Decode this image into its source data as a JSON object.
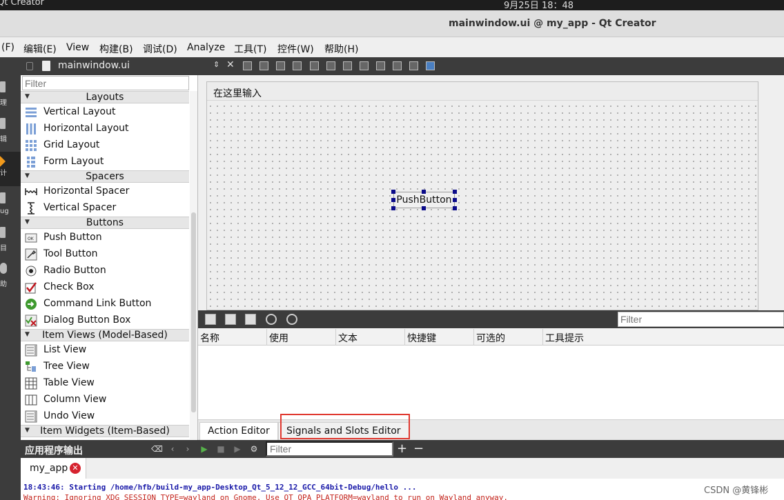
{
  "topbar": {
    "app_name": "Qt Creator",
    "clock": "9月25日  18：48"
  },
  "window": {
    "title": "mainwindow.ui @ my_app - Qt Creator"
  },
  "menubar": {
    "items": [
      "(F)",
      "编辑(E)",
      "View",
      "构建(B)",
      "调试(D)",
      "Analyze",
      "工具(T)",
      "控件(W)",
      "帮助(H)"
    ]
  },
  "modes": [
    {
      "label": "理",
      "icon": "welcome-icon"
    },
    {
      "label": "辑",
      "icon": "edit-icon"
    },
    {
      "label": "计",
      "icon": "design-icon"
    },
    {
      "label": "ug",
      "icon": "debug-icon"
    },
    {
      "label": "目",
      "icon": "projects-icon"
    },
    {
      "label": "助",
      "icon": "help-icon"
    }
  ],
  "widgetbox": {
    "file_name": "mainwindow.ui",
    "filter_placeholder": "Filter",
    "categories": [
      "Layouts",
      "Spacers",
      "Buttons",
      "Item Views (Model-Based)",
      "Item Widgets (Item-Based)"
    ],
    "items": [
      "Vertical Layout",
      "Horizontal Layout",
      "Grid Layout",
      "Form Layout",
      "Horizontal Spacer",
      "Vertical Spacer",
      "Push Button",
      "Tool Button",
      "Radio Button",
      "Check Box",
      "Command Link Button",
      "Dialog Button Box",
      "List View",
      "Tree View",
      "Table View",
      "Column View",
      "Undo View"
    ]
  },
  "form": {
    "menu_placeholder": "在这里输入",
    "button_text": "PushButton"
  },
  "action_editor": {
    "filter_placeholder": "Filter",
    "columns": [
      "名称",
      "使用",
      "文本",
      "快捷键",
      "可选的",
      "工具提示"
    ],
    "tabs": [
      "Action Editor",
      "Signals and Slots Editor"
    ]
  },
  "output": {
    "title": "应用程序输出",
    "filter_placeholder": "Filter",
    "tab_name": "my_app",
    "line1": "18:43:46: Starting /home/hfb/build-my_app-Desktop_Qt_5_12_12_GCC_64bit-Debug/hello ...",
    "line2": "Warning: Ignoring XDG_SESSION_TYPE=wayland on Gnome. Use QT_QPA_PLATFORM=wayland to run on Wayland anyway."
  },
  "watermark": "CSDN @黄锋彬",
  "colors": {
    "highlight": "#e0382f",
    "active_mode": "#f19a1c",
    "dark_panel": "#3c3c3c"
  }
}
